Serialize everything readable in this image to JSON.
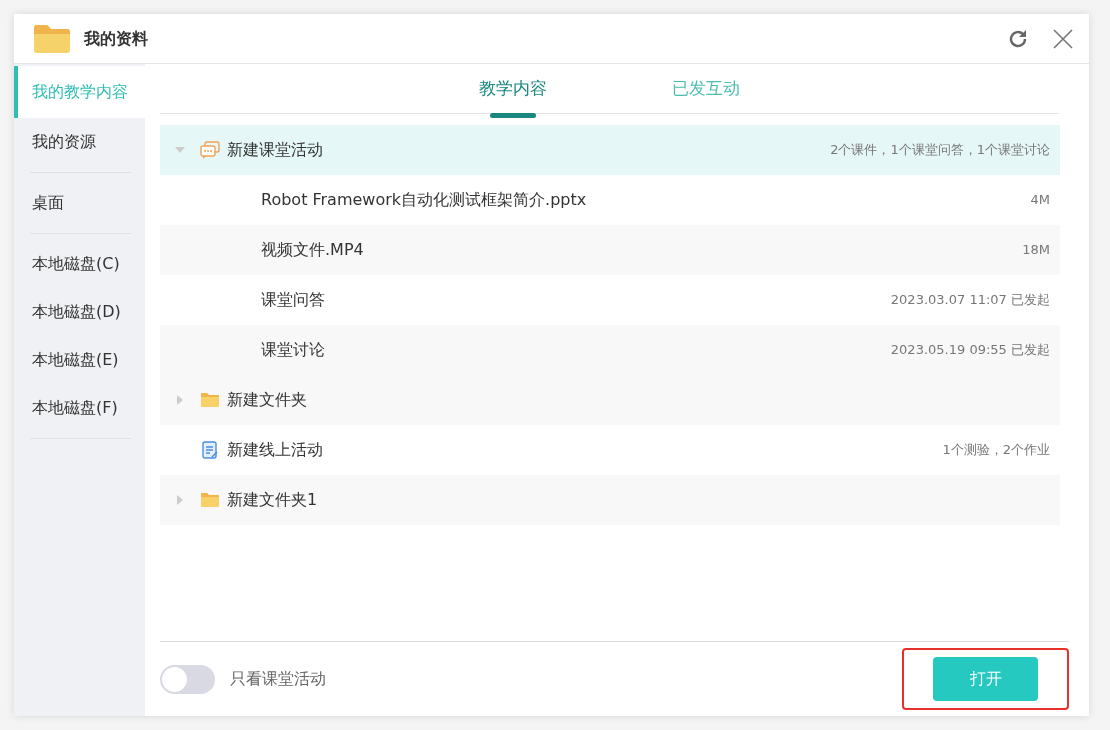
{
  "window": {
    "title": "我的资料"
  },
  "sidebar": {
    "groups": [
      [
        {
          "label": "我的教学内容",
          "selected": true
        },
        {
          "label": "我的资源",
          "selected": false
        }
      ],
      [
        {
          "label": "桌面",
          "selected": false
        }
      ],
      [
        {
          "label": "本地磁盘(C)",
          "selected": false
        },
        {
          "label": "本地磁盘(D)",
          "selected": false
        },
        {
          "label": "本地磁盘(E)",
          "selected": false
        },
        {
          "label": "本地磁盘(F)",
          "selected": false
        }
      ]
    ]
  },
  "tabs": [
    {
      "label": "教学内容",
      "selected": true
    },
    {
      "label": "已发互动",
      "selected": false
    }
  ],
  "tree": [
    {
      "kind": "activity",
      "name": "新建课堂活动",
      "info": "2个课件，1个课堂问答，1个课堂讨论",
      "selected": true,
      "expanded": true,
      "children": [
        {
          "name": "Robot Framework自动化测试框架简介.pptx",
          "info": "4M"
        },
        {
          "name": "视频文件.MP4",
          "info": "18M"
        },
        {
          "name": "课堂问答",
          "info": "2023.03.07 11:07 已发起"
        },
        {
          "name": "课堂讨论",
          "info": "2023.05.19 09:55 已发起"
        }
      ]
    },
    {
      "kind": "folder",
      "name": "新建文件夹",
      "selected": false,
      "expanded": false
    },
    {
      "kind": "online",
      "name": "新建线上活动",
      "info": "1个测验，2个作业",
      "selected": false
    },
    {
      "kind": "folder",
      "name": "新建文件夹1",
      "selected": false,
      "expanded": false
    }
  ],
  "footer": {
    "toggle": {
      "label": "只看课堂活动",
      "on": false
    },
    "open_button": {
      "label": "打开",
      "highlighted": true
    }
  }
}
